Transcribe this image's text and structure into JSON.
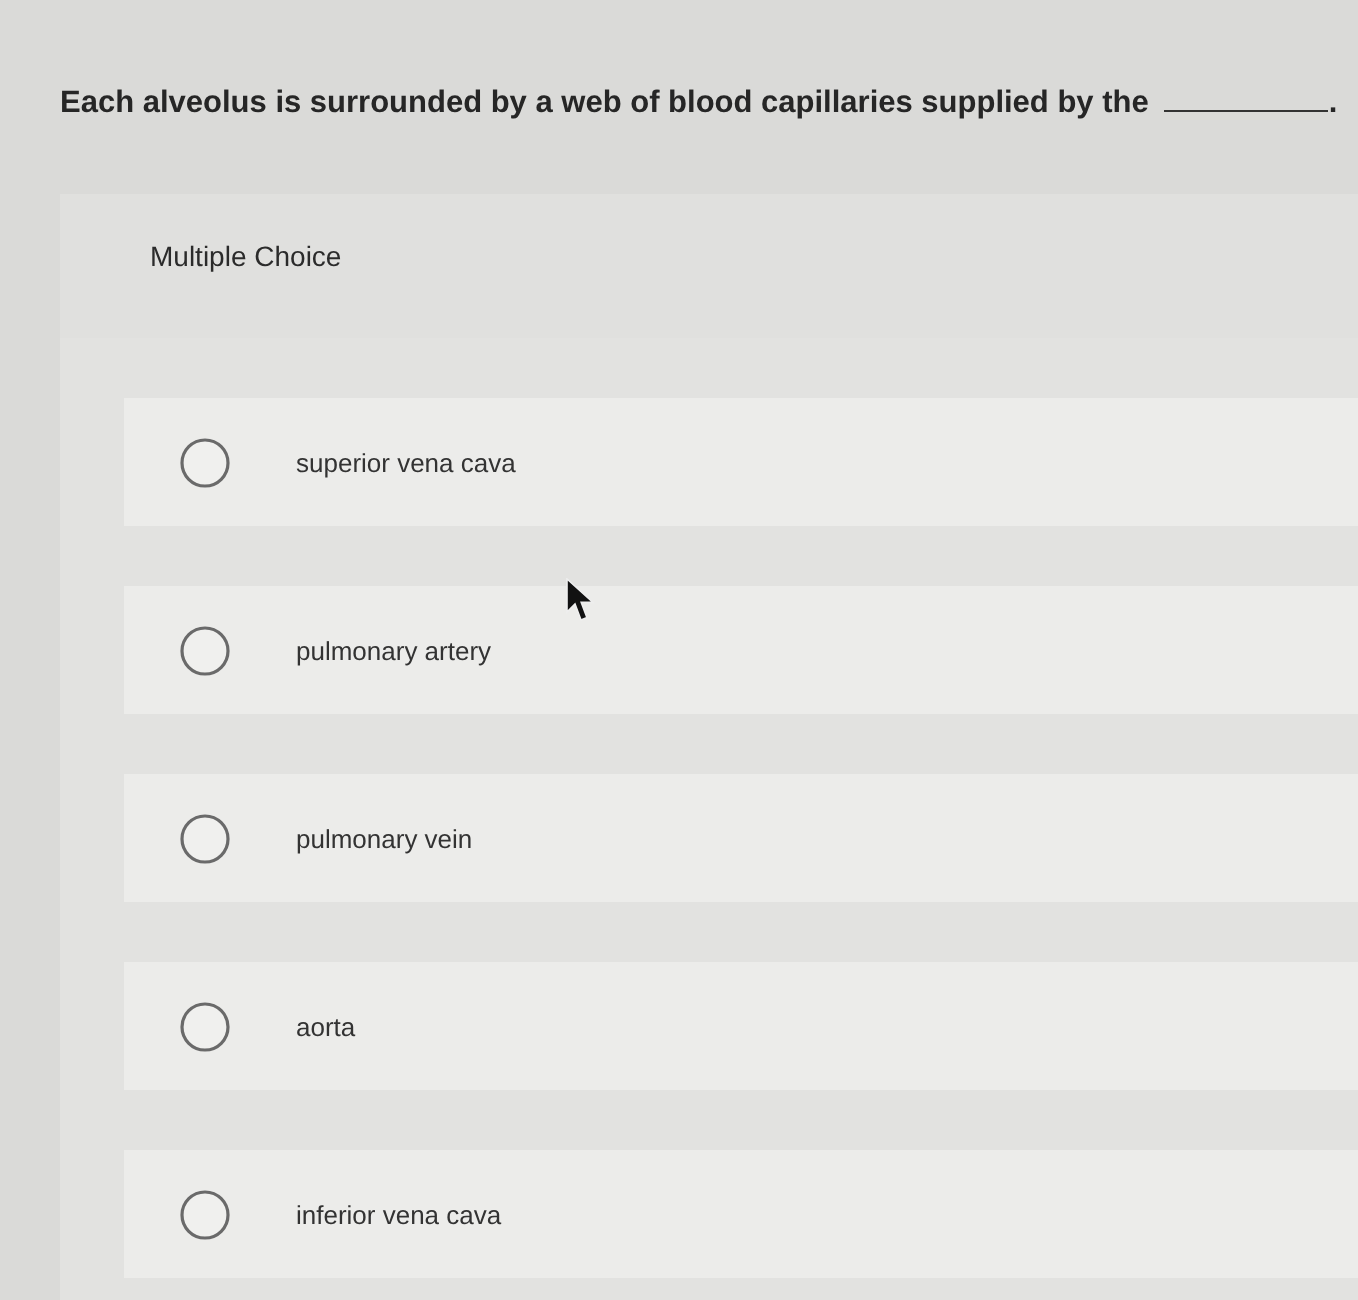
{
  "question": {
    "before_blank": "Each alveolus is surrounded by a web of blood capillaries supplied by the",
    "after_blank": "."
  },
  "panel": {
    "title": "Multiple Choice"
  },
  "options": [
    {
      "label": "superior vena cava",
      "selected": false
    },
    {
      "label": "pulmonary artery",
      "selected": false
    },
    {
      "label": "pulmonary vein",
      "selected": false
    },
    {
      "label": "aorta",
      "selected": false
    },
    {
      "label": "inferior vena cava",
      "selected": false
    }
  ]
}
